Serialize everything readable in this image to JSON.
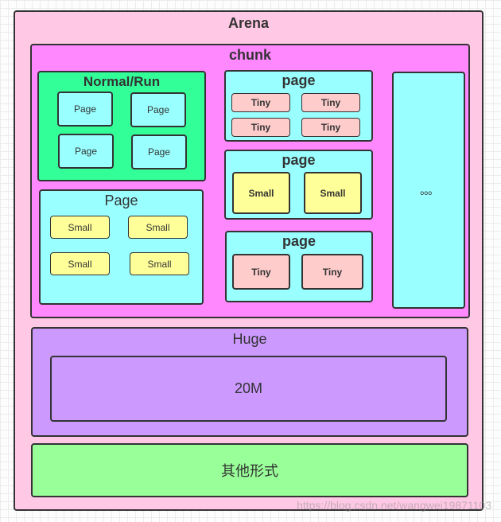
{
  "arena": {
    "title": "Arena"
  },
  "chunk": {
    "title": "chunk"
  },
  "normal_run": {
    "title": "Normal/Run",
    "pages": [
      "Page",
      "Page",
      "Page",
      "Page"
    ]
  },
  "small_page": {
    "title": "Page",
    "items": [
      "Small",
      "Small",
      "Small",
      "Small"
    ]
  },
  "page_tiny_grid": {
    "title": "page",
    "items": [
      "Tiny",
      "Tiny",
      "Tiny",
      "Tiny"
    ]
  },
  "page_small": {
    "title": "page",
    "items": [
      "Small",
      "Small"
    ]
  },
  "page_tiny": {
    "title": "page",
    "items": [
      "Tiny",
      "Tiny"
    ]
  },
  "more": {
    "label": "。。。"
  },
  "huge": {
    "title": "Huge",
    "inner": "20M"
  },
  "other": {
    "label": "其他形式"
  },
  "watermark": "https://blog.csdn.net/wangwei19871103",
  "colors": {
    "arena": "#ffc8e4",
    "chunk": "#ff88ff",
    "normal_run": "#33ff99",
    "page": "#99ffff",
    "small": "#ffff99",
    "tiny": "#ffcccc",
    "huge": "#cc99ff",
    "other": "#99ff99"
  }
}
